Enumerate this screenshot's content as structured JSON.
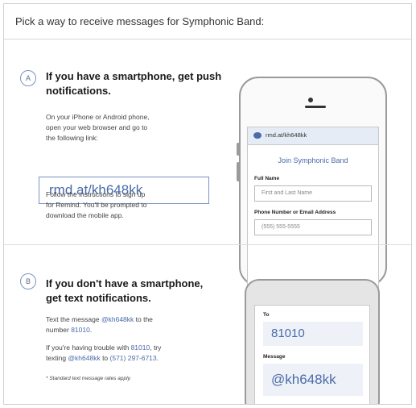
{
  "header": {
    "title": "Pick a way to receive messages for Symphonic Band:"
  },
  "section_a": {
    "badge": "A",
    "heading_line1": "If you have a smartphone, get push",
    "heading_line2": "notifications.",
    "instr_line1": "On your iPhone or Android phone,",
    "instr_line2": "open your web browser and go to",
    "instr_line3": "the following link:",
    "link": "rmd.at/kh648kk",
    "follow_line1": "Follow the instructions to sign up",
    "follow_line2": "for Remind. You'll be prompted to",
    "follow_line3": "download the mobile app."
  },
  "smartphone": {
    "url": "rmd.at/kh648kk",
    "join_title": "Join Symphonic Band",
    "full_name_label": "Full Name",
    "full_name_placeholder": "First and Last Name",
    "contact_label": "Phone Number or Email Address",
    "contact_placeholder": "(555) 555-5555"
  },
  "section_b": {
    "badge": "B",
    "heading_line1": "If you don't have a smartphone,",
    "heading_line2": "get text notifications.",
    "text_pre": "Text the message ",
    "code": "@kh648kk",
    "text_mid": " to the",
    "text_pre2": "number ",
    "number": "81010",
    "text_end": ".",
    "trouble_pre": "If you're having trouble with ",
    "trouble_number": "81010",
    "trouble_mid": ", try",
    "trouble_pre2": "texting ",
    "trouble_code": "@kh648kk",
    "trouble_mid2": " to ",
    "alt_number": "(571) 297-6713",
    "trouble_end": ".",
    "footnote": "* Standard text message rates apply."
  },
  "feature_phone": {
    "to_label": "To",
    "to_value": "81010",
    "message_label": "Message",
    "message_value": "@kh648kk"
  },
  "colors": {
    "accent": "#4a6aa8",
    "border": "#d0d0d0"
  }
}
